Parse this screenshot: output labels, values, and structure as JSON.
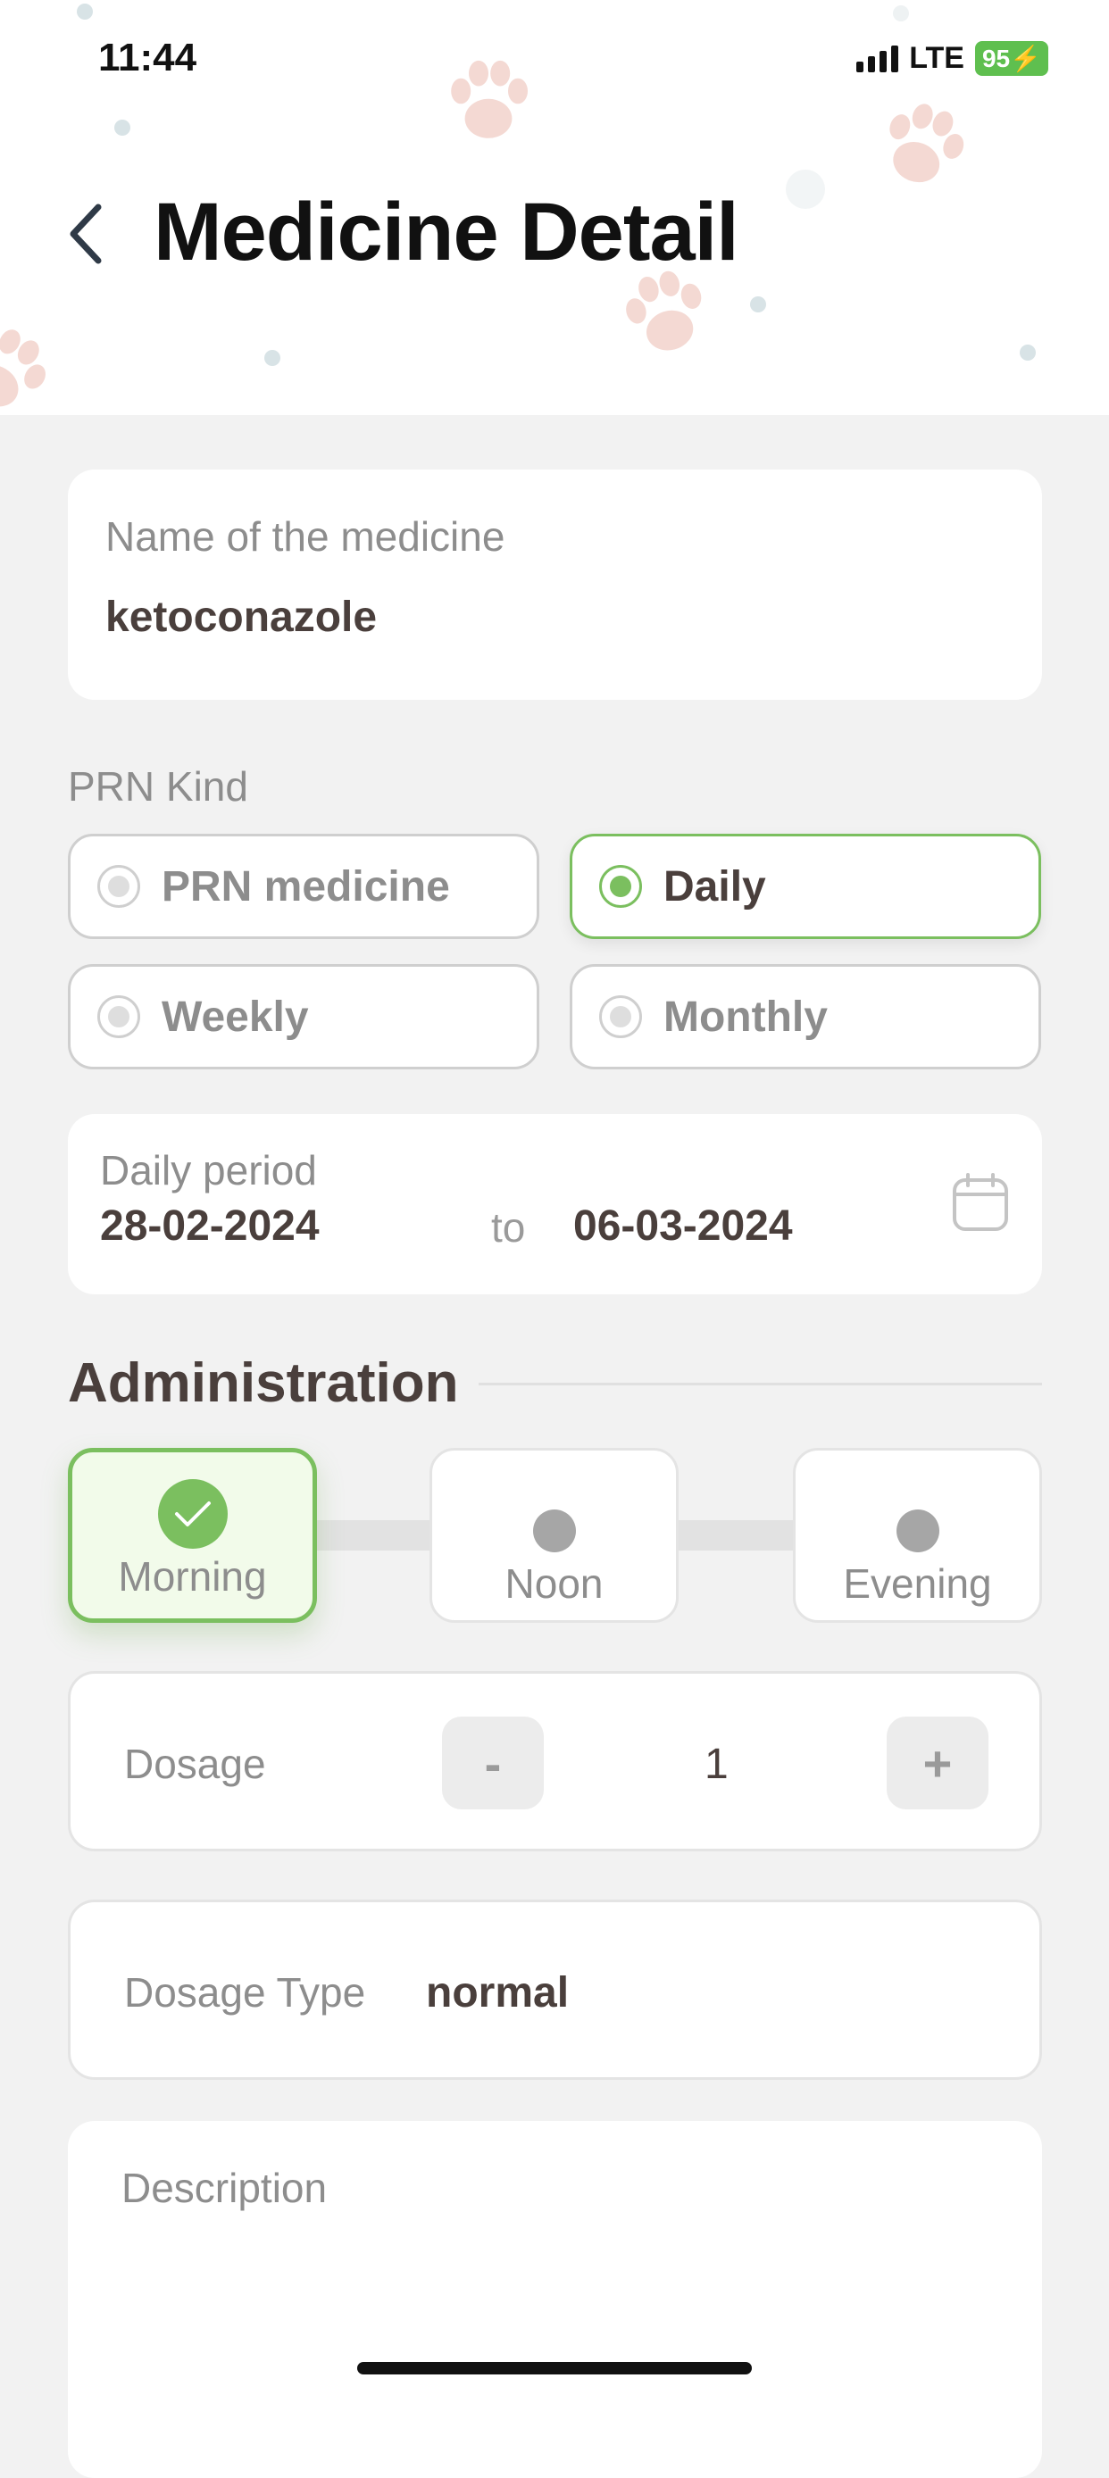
{
  "status_bar": {
    "time": "11:44",
    "network": "LTE",
    "battery": "95"
  },
  "header": {
    "title": "Medicine Detail",
    "back_icon": "chevron-left-icon"
  },
  "medicine_name": {
    "label": "Name of the medicine",
    "value": "ketoconazole"
  },
  "prn_kind": {
    "label": "PRN Kind",
    "selected": "Daily",
    "options": [
      {
        "label": "PRN medicine"
      },
      {
        "label": "Daily"
      },
      {
        "label": "Weekly"
      },
      {
        "label": "Monthly"
      }
    ]
  },
  "daily_period": {
    "label": "Daily period",
    "start": "28-02-2024",
    "separator": "to",
    "end": "06-03-2024",
    "icon": "calendar-icon"
  },
  "administration": {
    "title": "Administration",
    "selected": "Morning",
    "slots": [
      {
        "label": "Morning"
      },
      {
        "label": "Noon"
      },
      {
        "label": "Evening"
      }
    ]
  },
  "dosage": {
    "label": "Dosage",
    "minus": "-",
    "value": "1",
    "plus": "+"
  },
  "dosage_type": {
    "label": "Dosage Type",
    "value": "normal"
  },
  "description": {
    "label": "Description"
  },
  "colors": {
    "accent_green": "#7bbf5f",
    "text_dark": "#4a3f3c",
    "text_grey": "#8d8d8d",
    "background": "#f2f2f2"
  }
}
